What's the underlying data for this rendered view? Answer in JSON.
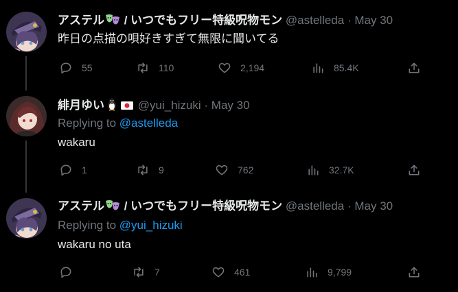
{
  "theme": {
    "background": "#000000",
    "text": "#e7e9ea",
    "muted": "#71767b",
    "link": "#1d9bf0",
    "divider": "#333639"
  },
  "tweets": [
    {
      "display_name": "アステル",
      "name_suffix": " / いつでもフリー特級呪物モン",
      "name_emoji": "theater-masks-emoji",
      "handle": "@astelleda",
      "separator": "·",
      "date": "May 30",
      "replying_label": "",
      "replying_to": "",
      "text": "昨日の点描の唄好きすぎて無限に聞いてる",
      "stats": {
        "replies": "55",
        "retweets": "110",
        "likes": "2,194",
        "views": "85.4K"
      }
    },
    {
      "display_name": "緋月ゆい",
      "name_suffix": "",
      "name_emoji": "penguin-and-flag-emoji",
      "handle": "@yui_hizuki",
      "separator": "·",
      "date": "May 30",
      "replying_label": "Replying to",
      "replying_to": "@astelleda",
      "text": "wakaru",
      "stats": {
        "replies": "1",
        "retweets": "9",
        "likes": "762",
        "views": "32.7K"
      }
    },
    {
      "display_name": "アステル",
      "name_suffix": " / いつでもフリー特級呪物モン",
      "name_emoji": "theater-masks-emoji",
      "handle": "@astelleda",
      "separator": "·",
      "date": "May 30",
      "replying_label": "Replying to",
      "replying_to": "@yui_hizuki",
      "text": "wakaru no uta",
      "stats": {
        "replies": "",
        "retweets": "7",
        "likes": "461",
        "views": "9,799"
      }
    }
  ]
}
